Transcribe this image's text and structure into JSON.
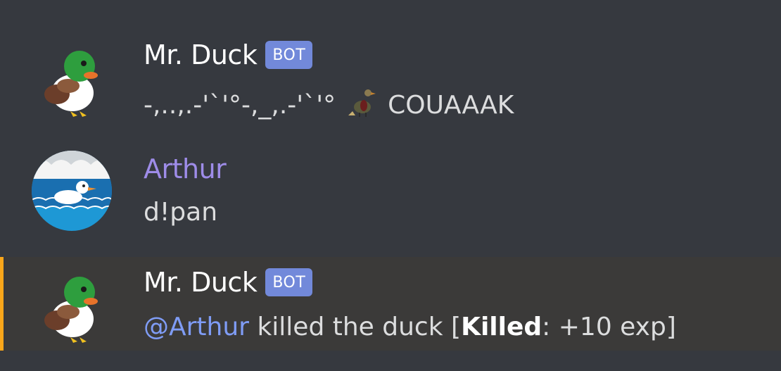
{
  "messages": [
    {
      "author": "Mr. Duck",
      "bot_tag": "BOT",
      "avatar_icon": "duck-bot-avatar",
      "text_prefix": "-,..,.-'`'°-,_,.-'`'°",
      "emoji_icon": "hunting-duck-icon",
      "text_suffix": "COUAAAK"
    },
    {
      "author": "Arthur",
      "author_color": "#9e8ce8",
      "avatar_icon": "swimming-duck-avatar",
      "text": "d!pan"
    },
    {
      "author": "Mr. Duck",
      "bot_tag": "BOT",
      "avatar_icon": "duck-bot-avatar",
      "mention": "@Arthur",
      "text_mid": "killed the duck [",
      "bold": "Killed",
      "text_end": ": +10 exp]",
      "highlighted": true
    }
  ],
  "colors": {
    "background": "#36393f",
    "highlight_background": "#3b3a39",
    "mention_bar": "#faa61a",
    "bot_tag": "#7289da",
    "mention": "#7f9cf5"
  }
}
